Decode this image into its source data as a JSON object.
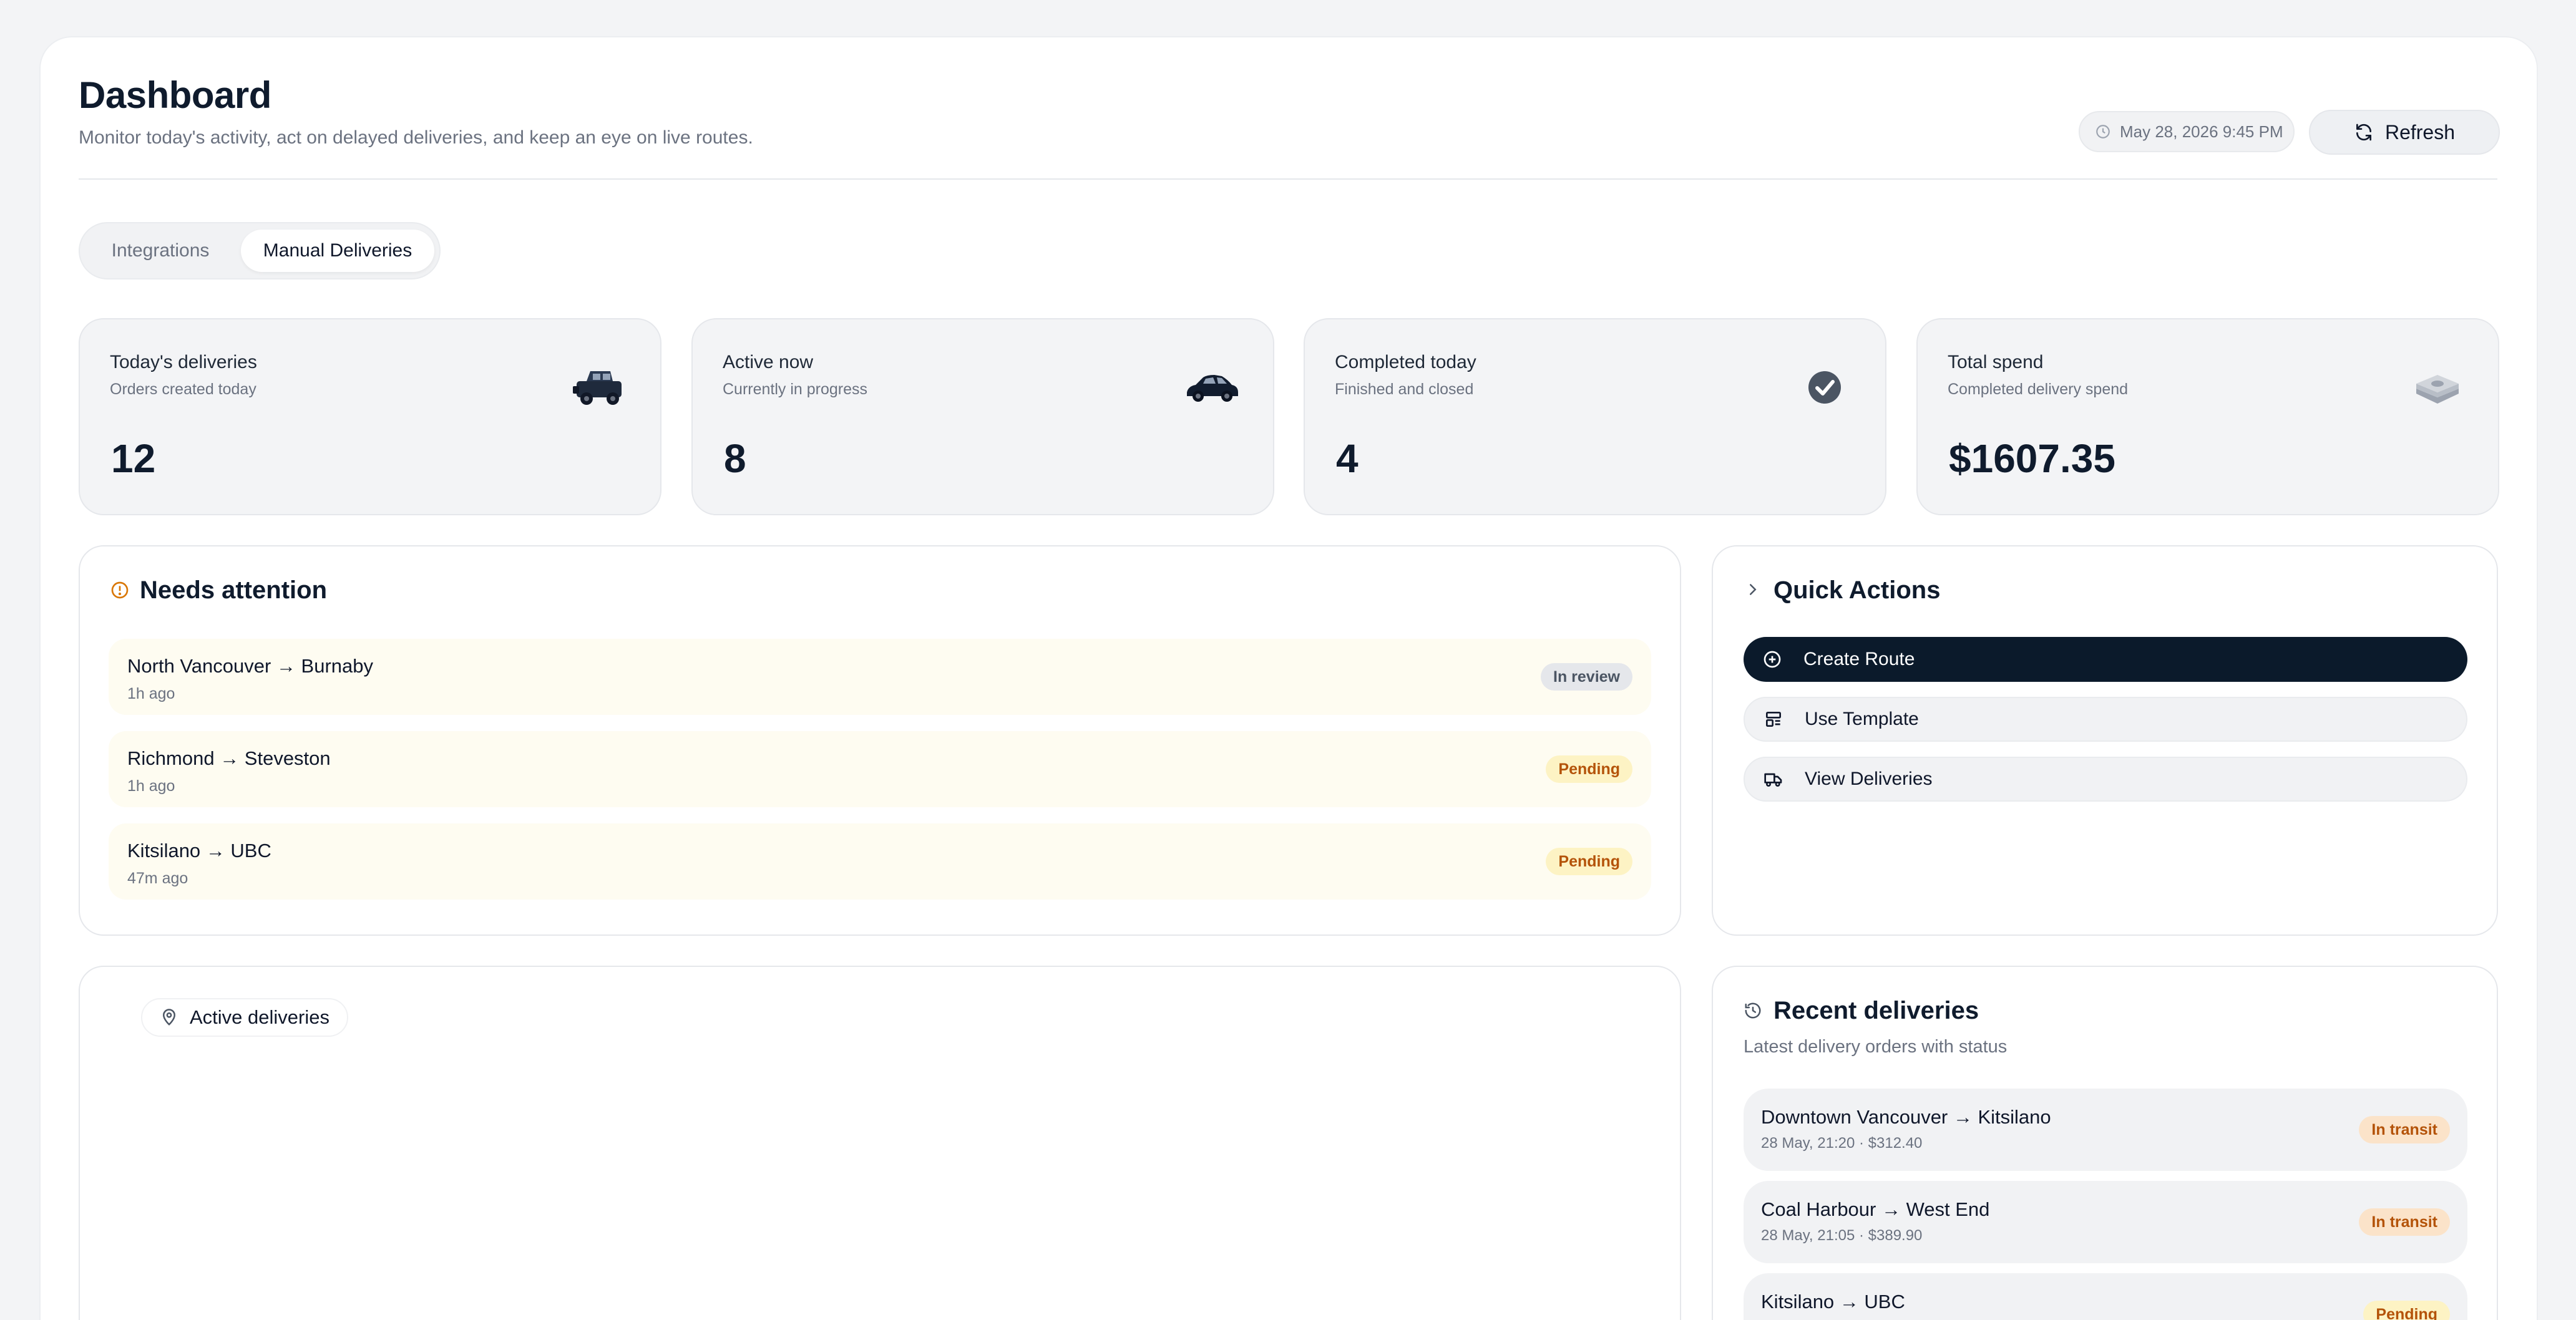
{
  "header": {
    "title": "Dashboard",
    "subtitle": "Monitor today's activity, act on delayed deliveries, and keep an eye on live routes.",
    "timestamp": "May 28, 2026 9:45 PM",
    "refresh_label": "Refresh"
  },
  "tabs": [
    {
      "label": "Integrations",
      "active": false
    },
    {
      "label": "Manual Deliveries",
      "active": true
    }
  ],
  "stats": [
    {
      "label": "Today's deliveries",
      "sub": "Orders created today",
      "value": "12",
      "icon": "jeep-icon"
    },
    {
      "label": "Active now",
      "sub": "Currently in progress",
      "value": "8",
      "icon": "car-icon"
    },
    {
      "label": "Completed today",
      "sub": "Finished and closed",
      "value": "4",
      "icon": "check-circle-icon"
    },
    {
      "label": "Total spend",
      "sub": "Completed delivery spend",
      "value": "$1607.35",
      "icon": "cash-stack-icon"
    }
  ],
  "attention": {
    "title": "Needs attention",
    "items": [
      {
        "route": "North Vancouver → Burnaby",
        "age": "1h ago",
        "status": "In review"
      },
      {
        "route": "Richmond → Steveston",
        "age": "1h ago",
        "status": "Pending"
      },
      {
        "route": "Kitsilano → UBC",
        "age": "47m ago",
        "status": "Pending"
      }
    ]
  },
  "quick_actions": {
    "title": "Quick Actions",
    "items": [
      {
        "label": "Create Route",
        "icon": "plus-circle-icon"
      },
      {
        "label": "Use Template",
        "icon": "template-icon"
      },
      {
        "label": "View Deliveries",
        "icon": "truck-icon"
      }
    ]
  },
  "active_deliveries": {
    "label": "Active deliveries"
  },
  "recent": {
    "title": "Recent deliveries",
    "subtitle": "Latest delivery orders with status",
    "items": [
      {
        "route": "Downtown Vancouver → Kitsilano",
        "meta": "28 May, 21:20  · $312.40",
        "status": "In transit"
      },
      {
        "route": "Coal Harbour → West End",
        "meta": "28 May, 21:05  · $389.90",
        "status": "In transit"
      },
      {
        "route": "Kitsilano → UBC",
        "meta": "",
        "status": "Pending"
      }
    ]
  },
  "colors": {
    "primary_dark": "#0b1a2b",
    "pending": "#b45309",
    "attention_icon": "#d97706"
  }
}
